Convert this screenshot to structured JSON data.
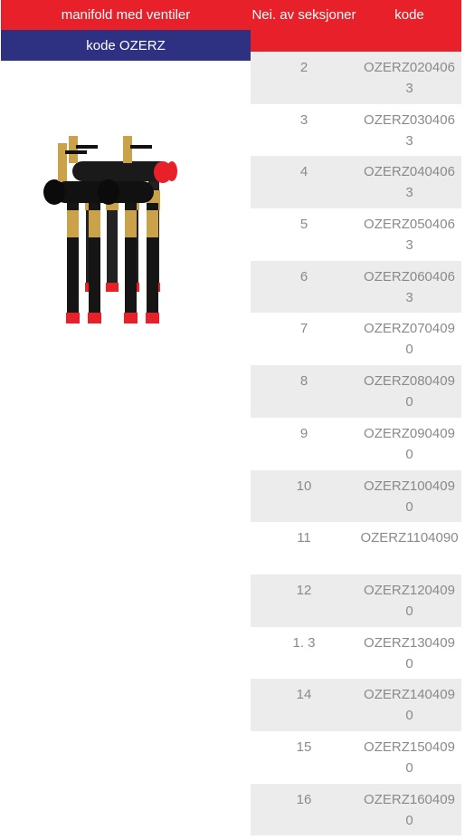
{
  "left": {
    "title": "manifold med ventiler",
    "subtitle": "kode OZERZ"
  },
  "table": {
    "headers": [
      "Nei. av seksjoner",
      "kode"
    ],
    "rows": [
      {
        "sections": "2",
        "code": "OZERZ0204063"
      },
      {
        "sections": "3",
        "code": "OZERZ0304063"
      },
      {
        "sections": "4",
        "code": "OZERZ0404063"
      },
      {
        "sections": "5",
        "code": "OZERZ0504063"
      },
      {
        "sections": "6",
        "code": "OZERZ0604063"
      },
      {
        "sections": "7",
        "code": "OZERZ0704090"
      },
      {
        "sections": "8",
        "code": "OZERZ0804090"
      },
      {
        "sections": "9",
        "code": "OZERZ0904090"
      },
      {
        "sections": "10",
        "code": "OZERZ1004090"
      },
      {
        "sections": "11",
        "code": "OZERZ1104090"
      },
      {
        "sections": "12",
        "code": "OZERZ1204090"
      },
      {
        "sections": "1. 3",
        "code": "OZERZ1304090"
      },
      {
        "sections": "14",
        "code": "OZERZ1404090"
      },
      {
        "sections": "15",
        "code": "OZERZ1504090"
      },
      {
        "sections": "16",
        "code": "OZERZ1604090"
      }
    ]
  },
  "colors": {
    "red": "#e8202a",
    "navy": "#2e3182",
    "row_alt": "#ececec",
    "text_gray": "#8a8a8a"
  }
}
